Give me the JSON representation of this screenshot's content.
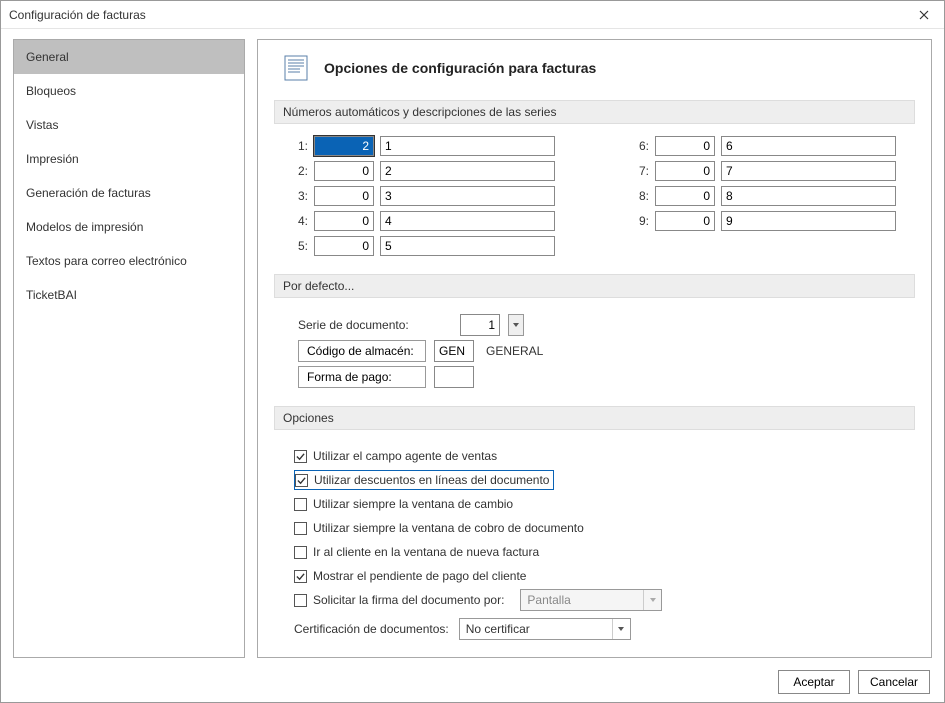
{
  "window": {
    "title": "Configuración de facturas"
  },
  "sidebar": {
    "items": [
      {
        "label": "General"
      },
      {
        "label": "Bloqueos"
      },
      {
        "label": "Vistas"
      },
      {
        "label": "Impresión"
      },
      {
        "label": "Generación de facturas"
      },
      {
        "label": "Modelos de impresión"
      },
      {
        "label": "Textos para correo electrónico"
      },
      {
        "label": "TicketBAI"
      }
    ]
  },
  "header": {
    "title": "Opciones de configuración para facturas"
  },
  "section_series": {
    "title": "Números automáticos y descripciones de las series",
    "rows": [
      {
        "label": "1:",
        "num": "2",
        "desc": "1"
      },
      {
        "label": "2:",
        "num": "0",
        "desc": "2"
      },
      {
        "label": "3:",
        "num": "0",
        "desc": "3"
      },
      {
        "label": "4:",
        "num": "0",
        "desc": "4"
      },
      {
        "label": "5:",
        "num": "0",
        "desc": "5"
      },
      {
        "label": "6:",
        "num": "0",
        "desc": "6"
      },
      {
        "label": "7:",
        "num": "0",
        "desc": "7"
      },
      {
        "label": "8:",
        "num": "0",
        "desc": "8"
      },
      {
        "label": "9:",
        "num": "0",
        "desc": "9"
      }
    ]
  },
  "section_defaults": {
    "title": "Por defecto...",
    "serie_label": "Serie de documento:",
    "serie_value": "1",
    "almacen_btn": "Código de almacén:",
    "almacen_code": "GEN",
    "almacen_desc": "GENERAL",
    "pago_btn": "Forma de pago:",
    "pago_code": ""
  },
  "section_options": {
    "title": "Opciones",
    "items": [
      {
        "checked": true,
        "label": "Utilizar el campo agente de ventas"
      },
      {
        "checked": true,
        "label": "Utilizar descuentos en líneas del documento"
      },
      {
        "checked": false,
        "label": "Utilizar siempre la ventana de cambio"
      },
      {
        "checked": false,
        "label": "Utilizar siempre la ventana de cobro de documento"
      },
      {
        "checked": false,
        "label": "Ir al cliente en la ventana de nueva factura"
      },
      {
        "checked": true,
        "label": "Mostrar el pendiente de pago del cliente"
      },
      {
        "checked": false,
        "label": "Solicitar la firma del documento por:"
      }
    ],
    "firma_select": "Pantalla",
    "cert_label": "Certificación de documentos:",
    "cert_select": "No certificar"
  },
  "footer": {
    "ok": "Aceptar",
    "cancel": "Cancelar"
  }
}
